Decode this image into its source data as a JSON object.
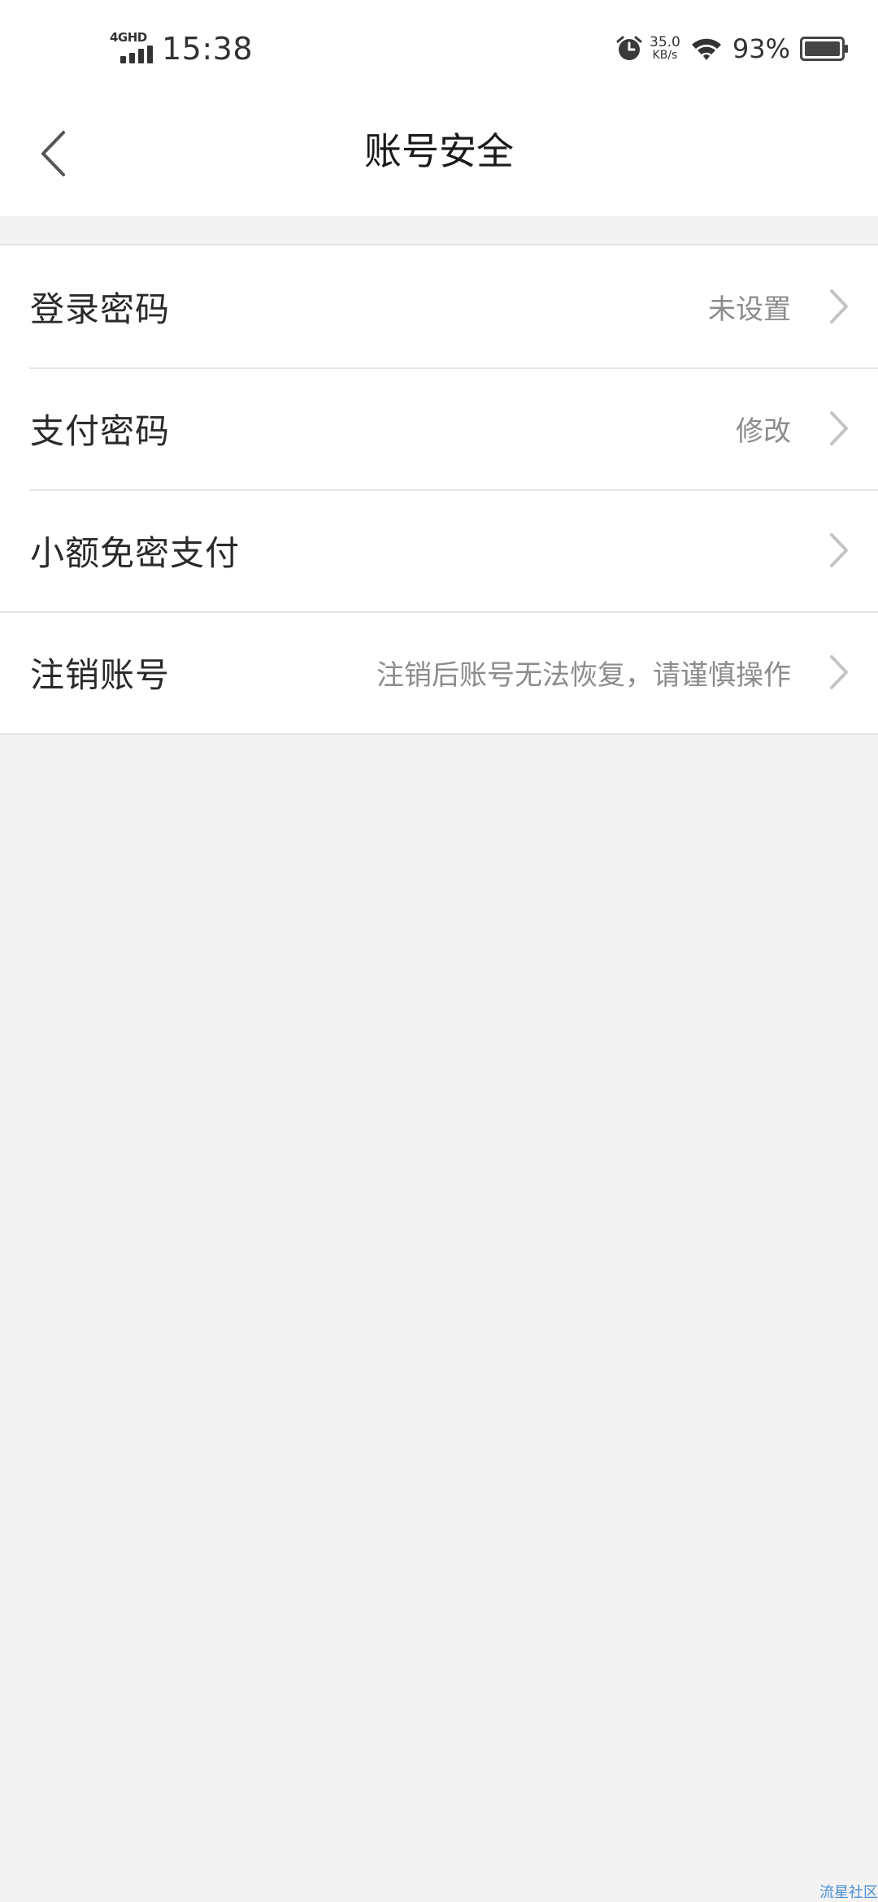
{
  "status_bar": {
    "network_type": "4GHD",
    "time": "15:38",
    "net_speed_value": "35.0",
    "net_speed_unit": "KB/s",
    "battery_percent": "93%",
    "icons": [
      "signal-icon",
      "alarm-icon",
      "wifi-icon",
      "battery-icon"
    ]
  },
  "header": {
    "back_icon": "chevron-left-icon",
    "title": "账号安全"
  },
  "settings": {
    "items": [
      {
        "label": "登录密码",
        "value": "未设置"
      },
      {
        "label": "支付密码",
        "value": "修改"
      },
      {
        "label": "小额免密支付",
        "value": ""
      },
      {
        "label": "注销账号",
        "value": "注销后账号无法恢复，请谨慎操作"
      }
    ],
    "chevron_icon": "chevron-right-icon"
  },
  "watermark": "流星社区",
  "colors": {
    "background": "#f3f3f3",
    "surface": "#ffffff",
    "divider": "#e6e6e6",
    "primary_text": "#2a2a2a",
    "secondary_text": "#8c8c8c",
    "chevron": "#c4c4c4"
  }
}
